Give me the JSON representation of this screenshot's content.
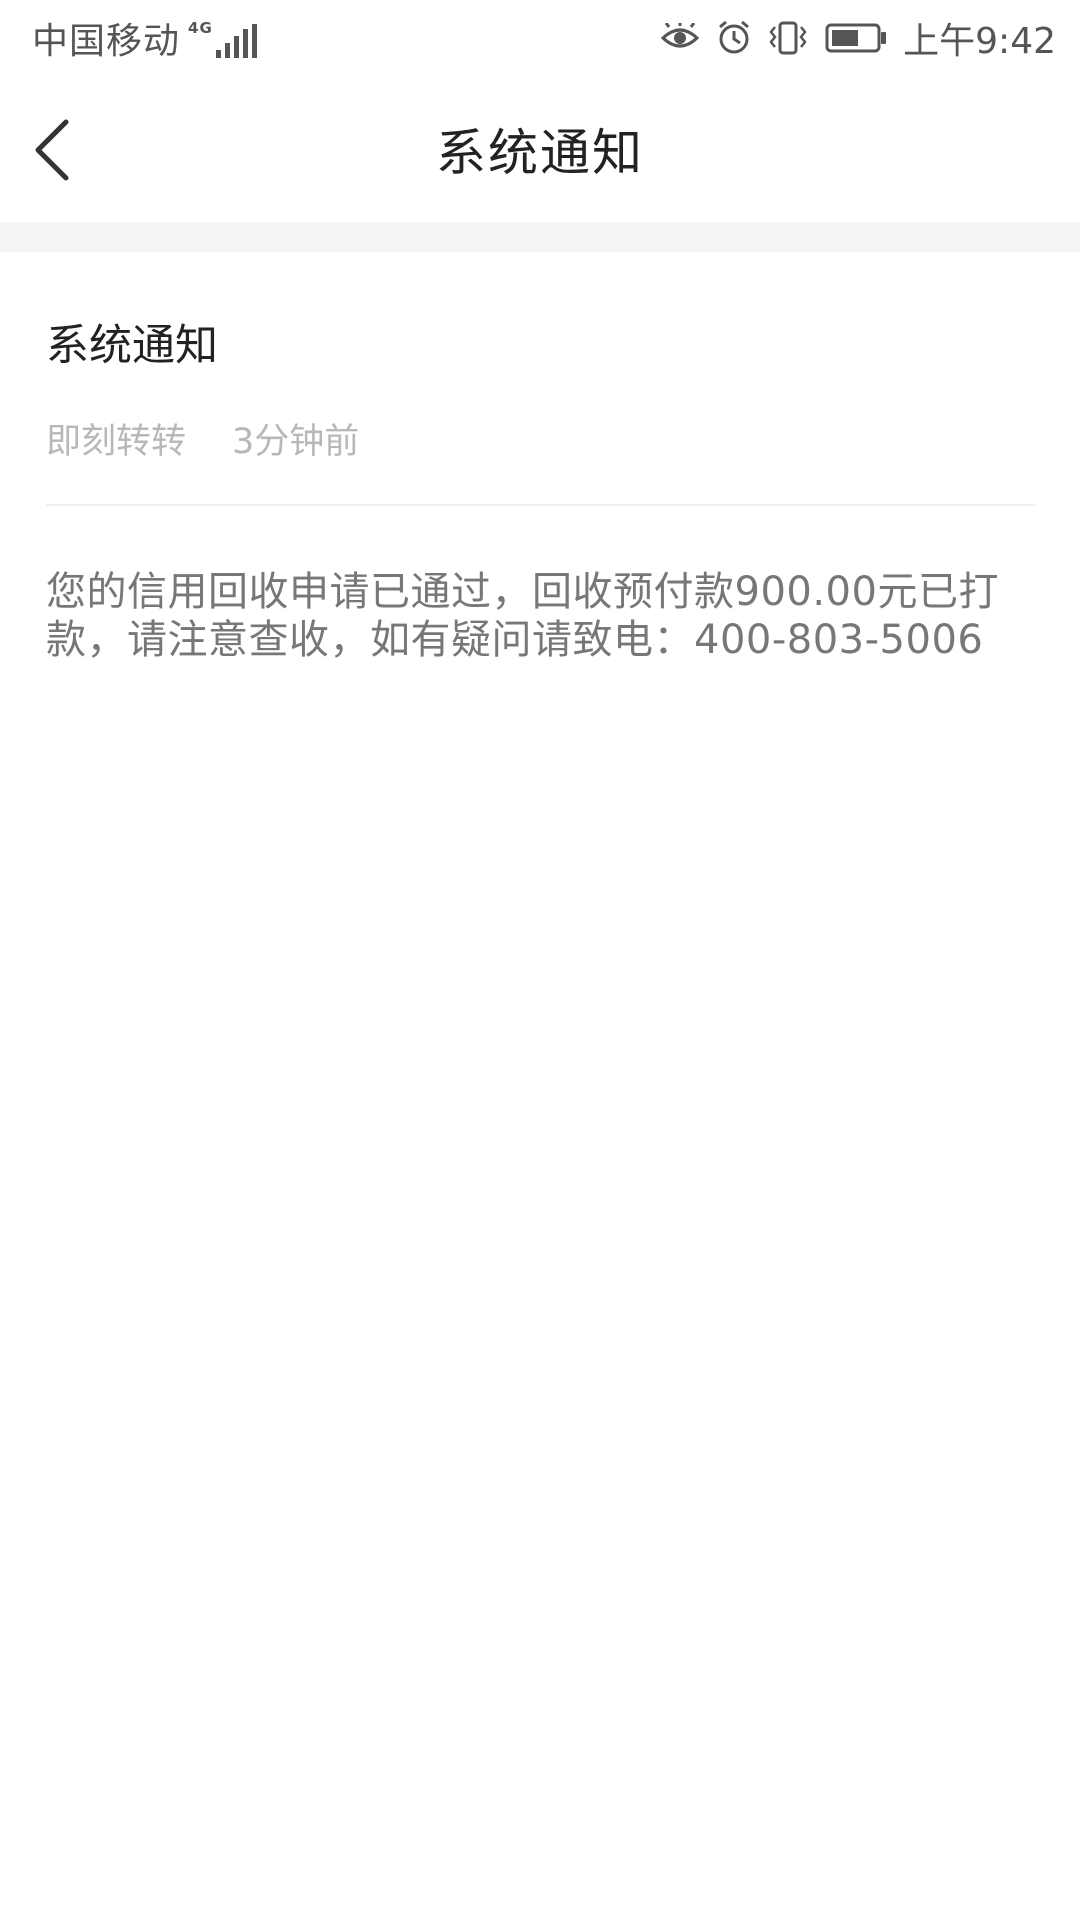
{
  "status_bar": {
    "carrier": "中国移动",
    "network": "4G",
    "time": "上午9:42",
    "icons": [
      "eye-icon",
      "alarm-icon",
      "vibrate-icon",
      "battery-icon"
    ]
  },
  "nav": {
    "title": "系统通知",
    "back_icon": "chevron-left-icon"
  },
  "notice": {
    "title": "系统通知",
    "sender": "即刻转转",
    "time_ago": "3分钟前",
    "body": "您的信用回收申请已通过，回收预付款900.00元已打款，请注意查收，如有疑问请致电：400-803-5006"
  },
  "colors": {
    "title_text": "#222222",
    "meta_text": "#b8b8b8",
    "body_text": "#777777",
    "separator": "#f5f5f5"
  }
}
